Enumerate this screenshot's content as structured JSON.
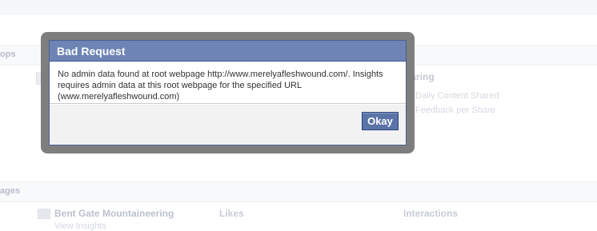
{
  "background": {
    "apps_section_label": "ops",
    "pages_section_label": "ages",
    "sharing_heading": "haring",
    "metrics": [
      "Daily Content Shared",
      "Feedback per Share"
    ],
    "page_row": {
      "name": "Bent Gate Mountaineering",
      "likes_heading": "Likes",
      "interactions_heading": "Interactions",
      "view_insights": "View Insights"
    }
  },
  "dialog": {
    "title": "Bad Request",
    "message": "No admin data found at root webpage http://www.merelyafleshwound.com/. Insights requires admin data at this root webpage for the specified URL (www.merelyafleshwound.com)",
    "ok_label": "Okay"
  },
  "colors": {
    "dialog_header_bg": "#6d84b4",
    "button_bg": "#5b74a8",
    "overlay_frame": "#7e7e7e"
  }
}
